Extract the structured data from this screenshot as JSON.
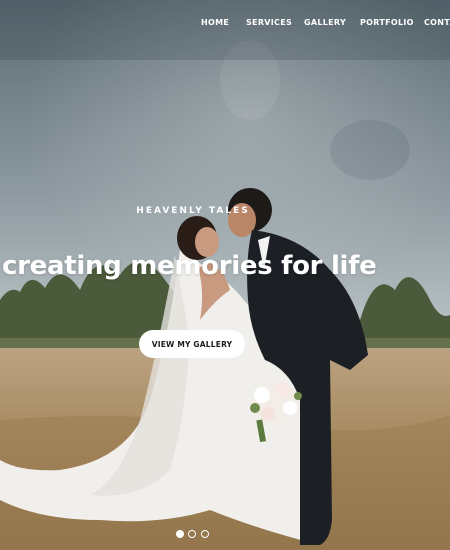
{
  "nav": {
    "items": [
      {
        "label": "HOME"
      },
      {
        "label": "SERVICES"
      },
      {
        "label": "GALLERY"
      },
      {
        "label": "PORTFOLIO"
      },
      {
        "label": "CONTA"
      }
    ]
  },
  "hero": {
    "eyebrow": "HEAVENLY TALES",
    "headline": "creating memories for life",
    "cta_label": "VIEW MY GALLERY",
    "slide_count": 3,
    "active_slide": 1
  },
  "colors": {
    "text": "#ffffff",
    "sky_top": "#5b6a72",
    "field": "#a4875c",
    "cta_bg": "#ffffff",
    "cta_text": "#1d1d1d"
  }
}
